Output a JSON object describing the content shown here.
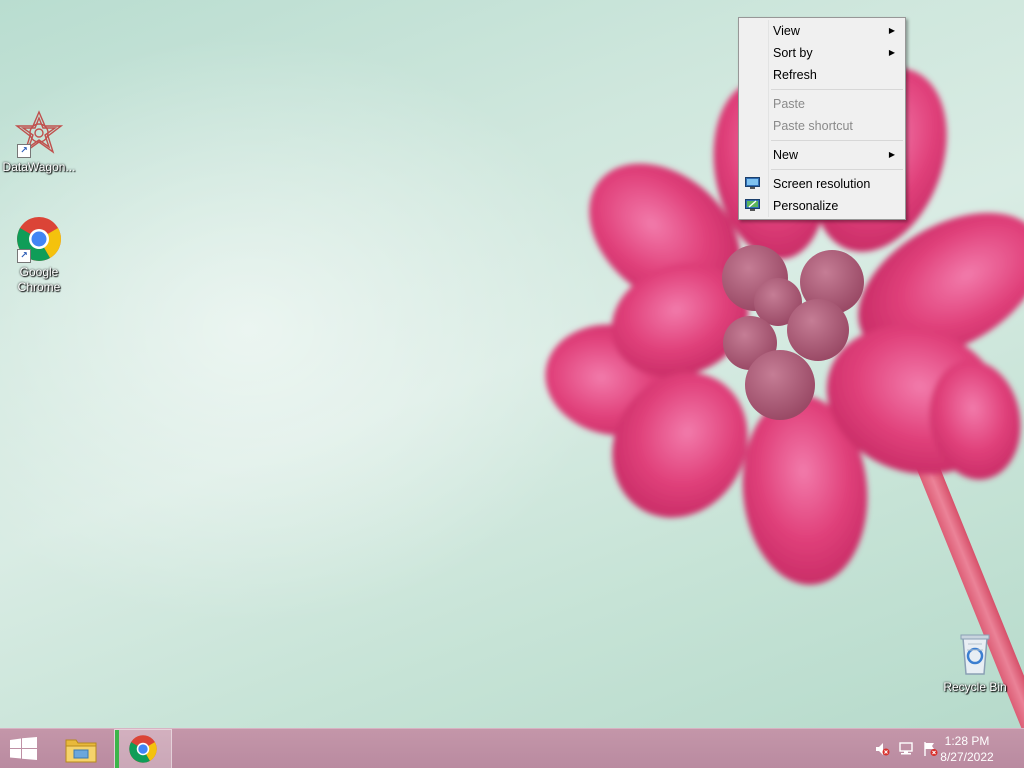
{
  "desktop": {
    "icons": [
      {
        "label": "DataWagon...",
        "icon": "datawagon-icon"
      },
      {
        "label": "Google Chrome",
        "icon": "chrome-icon"
      },
      {
        "label": "Recycle Bin",
        "icon": "recycle-bin-icon"
      }
    ]
  },
  "context_menu": {
    "items": [
      {
        "label": "View",
        "submenu": true
      },
      {
        "label": "Sort by",
        "submenu": true
      },
      {
        "label": "Refresh"
      },
      {
        "label": "Paste",
        "disabled": true
      },
      {
        "label": "Paste shortcut",
        "disabled": true
      },
      {
        "label": "New",
        "submenu": true
      },
      {
        "label": "Screen resolution",
        "icon": "screen-resolution-icon"
      },
      {
        "label": "Personalize",
        "icon": "personalize-icon"
      }
    ],
    "submenu_arrow": "▶"
  },
  "taskbar": {
    "start": "start-button",
    "pinned": [
      "file-explorer-icon",
      "chrome-icon"
    ],
    "tray_icons": [
      "volume-muted-icon",
      "network-icon",
      "action-center-flag-icon"
    ],
    "clock": {
      "time": "1:28 PM",
      "date": "8/27/2022"
    }
  },
  "colors": {
    "taskbar": "#bd8fa4",
    "menu_bg": "#f0f0f0",
    "flower": "#e0407a"
  }
}
